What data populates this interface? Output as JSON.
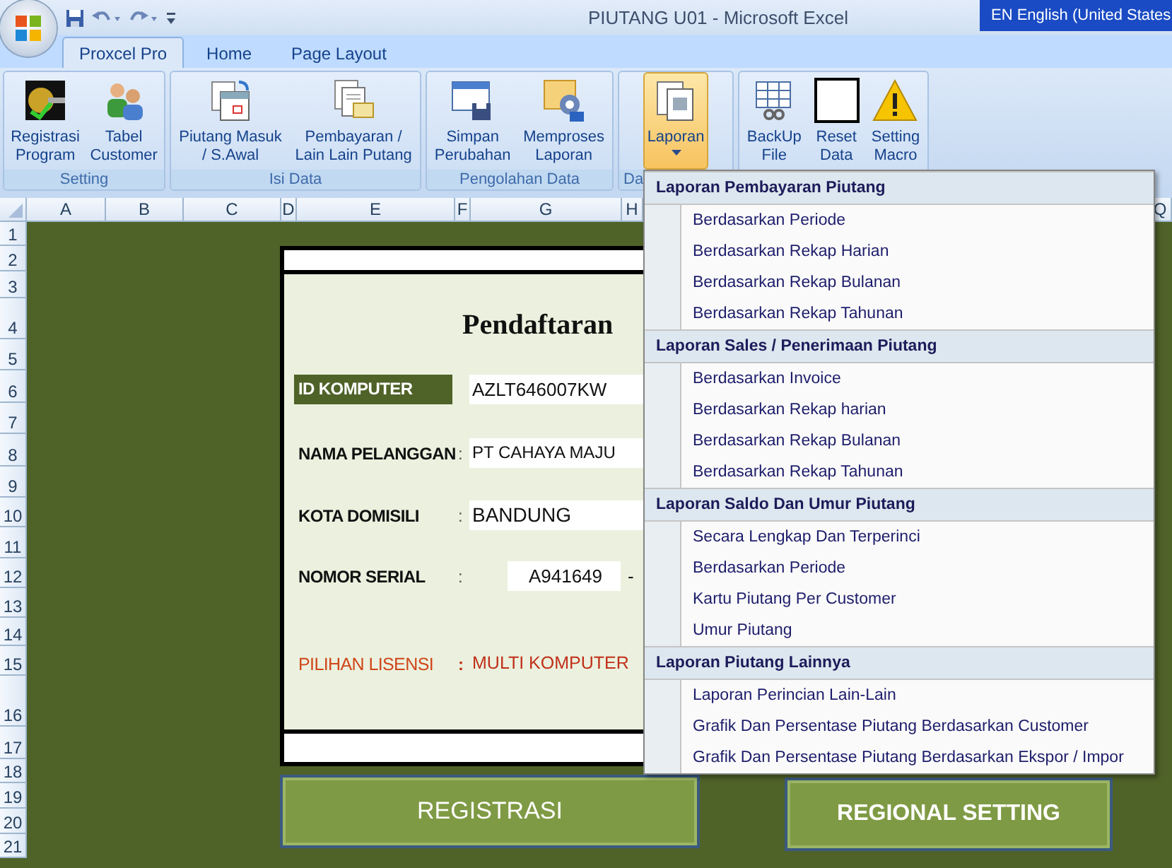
{
  "window": {
    "title": "PIUTANG U01 - Microsoft Excel"
  },
  "language_bar": {
    "label": "EN English (United States"
  },
  "tabs": [
    {
      "label": "Proxcel Pro",
      "selected": true
    },
    {
      "label": "Home",
      "selected": false
    },
    {
      "label": "Page Layout",
      "selected": false
    }
  ],
  "ribbon": {
    "groups": [
      {
        "label": "Setting",
        "buttons": [
          {
            "lines": [
              "Registrasi",
              "Program"
            ],
            "selected": false
          },
          {
            "lines": [
              "Tabel",
              "Customer"
            ],
            "selected": false
          }
        ]
      },
      {
        "label": "Isi Data",
        "buttons": [
          {
            "lines": [
              "Piutang Masuk",
              "/ S.Awal"
            ],
            "selected": false
          },
          {
            "lines": [
              "Pembayaran /",
              "Lain Lain Putang"
            ],
            "selected": false
          }
        ]
      },
      {
        "label": "Pengolahan Data",
        "buttons": [
          {
            "lines": [
              "Simpan",
              "Perubahan"
            ],
            "selected": false
          },
          {
            "lines": [
              "Memproses",
              "Laporan"
            ],
            "selected": false
          }
        ]
      },
      {
        "label": "Da",
        "buttons": [
          {
            "lines": [
              "Laporan"
            ],
            "selected": true,
            "dropdown": true
          }
        ]
      },
      {
        "buttons": [
          {
            "lines": [
              "BackUp",
              "File"
            ],
            "selected": false
          },
          {
            "lines": [
              "Reset",
              "Data"
            ],
            "selected": false
          },
          {
            "lines": [
              "Setting",
              "Macro"
            ],
            "selected": false
          }
        ]
      }
    ]
  },
  "sheet": {
    "columns": [
      "A",
      "B",
      "C",
      "D",
      "E",
      "F",
      "G",
      "H"
    ],
    "far_column": "Q",
    "rows": [
      "1",
      "2",
      "3",
      "4",
      "5",
      "6",
      "7",
      "8",
      "9",
      "10",
      "11",
      "12",
      "13",
      "14",
      "15",
      "16",
      "17",
      "18",
      "19",
      "20",
      "21"
    ]
  },
  "form": {
    "title": "Pendaftaran",
    "fields": [
      {
        "label": "ID KOMPUTER",
        "value": "AZLT646007KW",
        "kind": "highlight"
      },
      {
        "label": "NAMA PELANGGAN",
        "separator": ":",
        "value": "PT CAHAYA MAJU",
        "kind": "plain"
      },
      {
        "label": "KOTA DOMISILI",
        "separator": ":",
        "value": "BANDUNG",
        "kind": "large"
      },
      {
        "label": "NOMOR SERIAL",
        "separator": ":",
        "value": "A941649",
        "suffix": "-",
        "kind": "serial"
      },
      {
        "label": "PILIHAN LISENSI",
        "separator": ":",
        "value": "MULTI KOMPUTER",
        "kind": "license"
      }
    ]
  },
  "buttons": [
    {
      "label": "REGISTRASI",
      "kind": "light"
    },
    {
      "label": "REGIONAL SETTING",
      "kind": "bold"
    }
  ],
  "menu": {
    "sections": [
      {
        "header": "Laporan Pembayaran Piutang",
        "items": [
          "Berdasarkan Periode",
          "Berdasarkan Rekap Harian",
          "Berdasarkan Rekap Bulanan",
          "Berdasarkan Rekap Tahunan"
        ]
      },
      {
        "header": "Laporan Sales / Penerimaan Piutang",
        "items": [
          "Berdasarkan Invoice",
          "Berdasarkan Rekap harian",
          "Berdasarkan Rekap Bulanan",
          "Berdasarkan Rekap Tahunan"
        ]
      },
      {
        "header": "Laporan Saldo Dan Umur Piutang",
        "items": [
          "Secara Lengkap Dan Terperinci",
          "Berdasarkan Periode",
          "Kartu Piutang Per Customer",
          "Umur Piutang"
        ]
      },
      {
        "header": "Laporan Piutang Lainnya",
        "items": [
          "Laporan Perincian Lain-Lain",
          "Grafik Dan Persentase Piutang Berdasarkan Customer",
          "Grafik Dan Persentase Piutang Berdasarkan Ekspor / Impor"
        ]
      }
    ]
  }
}
